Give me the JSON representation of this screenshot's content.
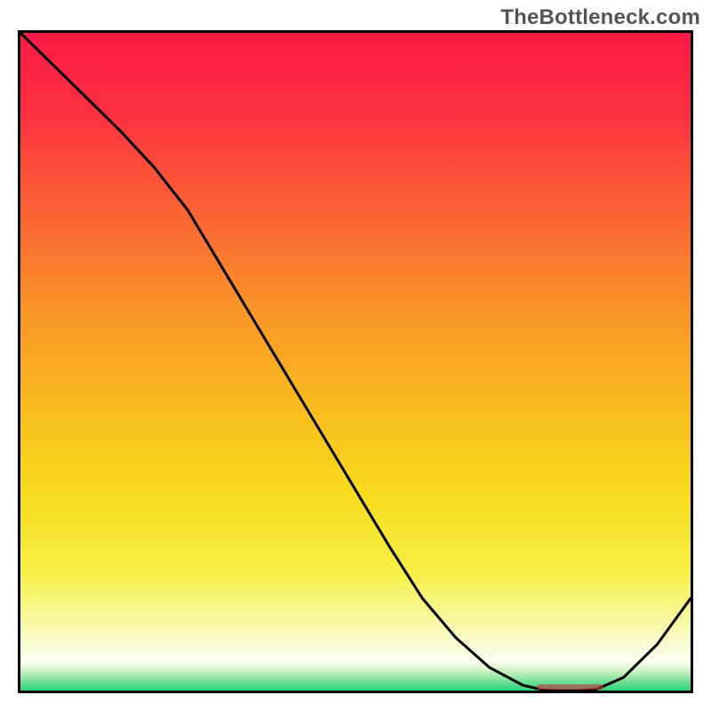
{
  "attribution": {
    "watermark": "TheBottleneck.com"
  },
  "colors": {
    "border": "#000000",
    "curve": "#000000",
    "marker": "#c63a46",
    "gradient_stops": [
      {
        "offset": 0.0,
        "color": "#fb1a45"
      },
      {
        "offset": 0.12,
        "color": "#fc3040"
      },
      {
        "offset": 0.28,
        "color": "#fb6534"
      },
      {
        "offset": 0.42,
        "color": "#fa9427"
      },
      {
        "offset": 0.56,
        "color": "#f8b91e"
      },
      {
        "offset": 0.7,
        "color": "#f7db1f"
      },
      {
        "offset": 0.82,
        "color": "#f6ef45"
      },
      {
        "offset": 0.9,
        "color": "#f8f9aa"
      },
      {
        "offset": 0.955,
        "color": "#fcfef2"
      },
      {
        "offset": 0.97,
        "color": "#cdf3c3"
      },
      {
        "offset": 0.985,
        "color": "#7ae19a"
      },
      {
        "offset": 1.0,
        "color": "#2bd37d"
      }
    ]
  },
  "chart_data": {
    "type": "line",
    "title": "",
    "xlabel": "",
    "ylabel": "",
    "xlim": [
      0,
      100
    ],
    "ylim": [
      0,
      100
    ],
    "x": [
      0,
      5,
      10,
      15,
      20,
      25,
      30,
      35,
      40,
      45,
      50,
      55,
      60,
      65,
      70,
      75,
      78,
      80,
      83,
      86,
      90,
      95,
      100
    ],
    "values": [
      100.0,
      95.0,
      90.0,
      85.0,
      79.5,
      73.0,
      64.5,
      56.0,
      47.5,
      39.0,
      30.5,
      22.0,
      14.0,
      8.0,
      3.5,
      0.8,
      0.1,
      0.0,
      0.0,
      0.2,
      2.0,
      7.0,
      14.0
    ],
    "minimum_marker": {
      "x_start": 77,
      "x_end": 87,
      "y": 0.1
    },
    "notes": "Values are bottleneck-like percentage (100 at top of plot, 0 at bottom). Curve descends from top-left, flattens near x≈78–86 at y≈0, then rises toward the right edge."
  }
}
